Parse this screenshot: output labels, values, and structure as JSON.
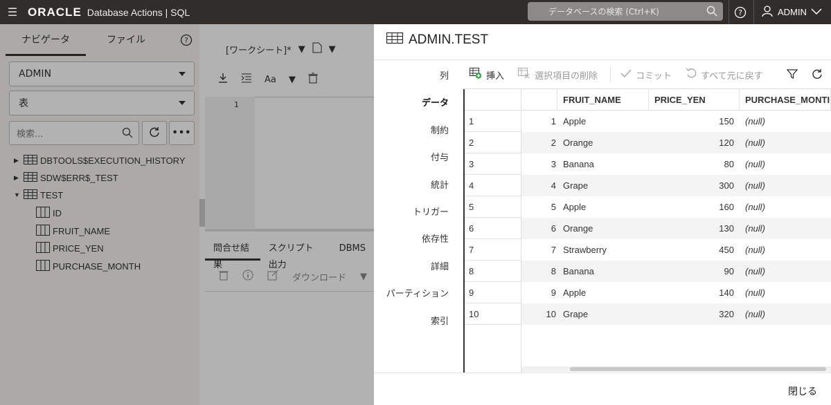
{
  "topbar": {
    "logo": "ORACLE",
    "product": "Database Actions |  SQL",
    "search_placeholder": "データベースの検索 (Ctrl+K)",
    "user": "ADMIN"
  },
  "navigator": {
    "tab_navigator": "ナビゲータ",
    "tab_files": "ファイル",
    "schema": "ADMIN",
    "object_type": "表",
    "search_placeholder": "検索...",
    "tree": [
      {
        "label": "DBTOOLS$EXECUTION_HISTORY",
        "expanded": false
      },
      {
        "label": "SDW$ERR$_TEST",
        "expanded": false
      },
      {
        "label": "TEST",
        "expanded": true
      }
    ],
    "columns": [
      "ID",
      "FRUIT_NAME",
      "PRICE_YEN",
      "PURCHASE_MONTH"
    ]
  },
  "editor": {
    "worksheet_tab": "[ワークシート]*",
    "font_label": "Aa",
    "line_number": "1",
    "results_tabs": [
      "問合せ結果",
      "スクリプト出力",
      "DBMS"
    ],
    "download": "ダウンロード"
  },
  "panel": {
    "title": "ADMIN.TEST",
    "side_menu": [
      "列",
      "データ",
      "制約",
      "付与",
      "統計",
      "トリガー",
      "依存性",
      "詳細",
      "パーティション",
      "索引"
    ],
    "toolbar": {
      "insert": "挿入",
      "delete_selected": "選択項目の削除",
      "commit": "コミット",
      "revert_all": "すべて元に戻す"
    },
    "grid": {
      "columns": [
        "FRUIT_NAME",
        "PRICE_YEN",
        "PURCHASE_MONTI"
      ],
      "rows": [
        {
          "num": "1",
          "idx": "1",
          "name": "Apple",
          "price": "150",
          "month": "(null)"
        },
        {
          "num": "2",
          "idx": "2",
          "name": "Orange",
          "price": "120",
          "month": "(null)"
        },
        {
          "num": "3",
          "idx": "3",
          "name": "Banana",
          "price": "80",
          "month": "(null)"
        },
        {
          "num": "4",
          "idx": "4",
          "name": "Grape",
          "price": "300",
          "month": "(null)"
        },
        {
          "num": "5",
          "idx": "5",
          "name": "Apple",
          "price": "160",
          "month": "(null)"
        },
        {
          "num": "6",
          "idx": "6",
          "name": "Orange",
          "price": "130",
          "month": "(null)"
        },
        {
          "num": "7",
          "idx": "7",
          "name": "Strawberry",
          "price": "450",
          "month": "(null)"
        },
        {
          "num": "8",
          "idx": "8",
          "name": "Banana",
          "price": "90",
          "month": "(null)"
        },
        {
          "num": "9",
          "idx": "9",
          "name": "Apple",
          "price": "140",
          "month": "(null)"
        },
        {
          "num": "10",
          "idx": "10",
          "name": "Grape",
          "price": "320",
          "month": "(null)"
        }
      ]
    },
    "close": "閉じる"
  },
  "colors": {
    "topbar_bg": "#312d2a",
    "insert_icon_accent": "#2e9d43",
    "overlay": "rgba(0,0,0,0.30)"
  }
}
